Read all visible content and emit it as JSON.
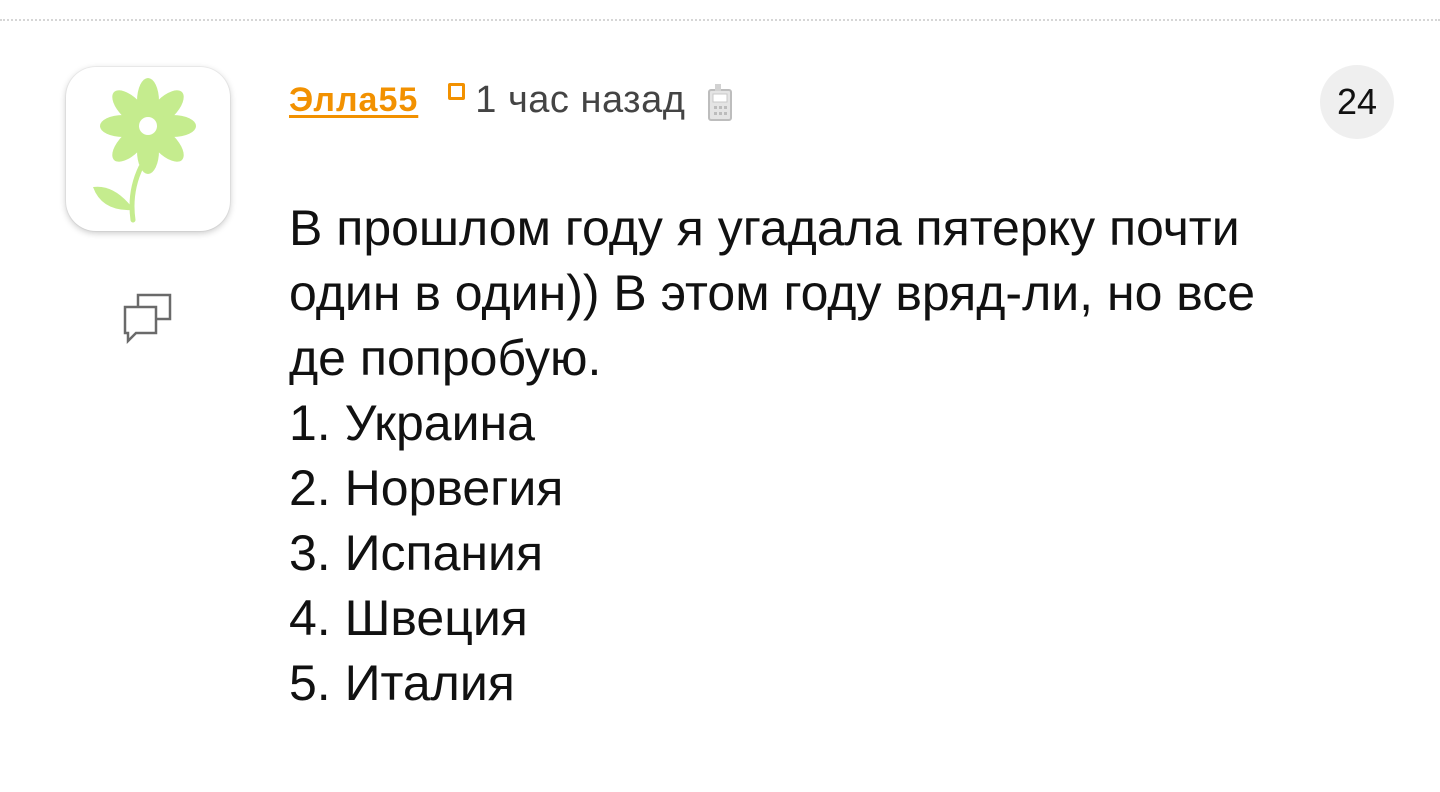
{
  "comment": {
    "author": "Элла55",
    "time": "1 час назад",
    "reply_count": "24",
    "text_lines": [
      "В прошлом году я угадала пятерку почти",
      "один в один)) В этом году вряд-ли, но все",
      "де попробую.",
      "1. Украина",
      "2. Норвегия",
      "3. Испания",
      "4. Швеция",
      "5. Италия"
    ]
  },
  "icons": {
    "avatar": "flower-avatar-icon",
    "status": "status-square-icon",
    "device": "mobile-phone-icon",
    "reply": "chat-bubbles-icon"
  },
  "colors": {
    "author": "#f29100",
    "status_square": "#f29100",
    "flower": "#c5ec8e",
    "badge_background": "#efefef",
    "text": "#111111",
    "muted": "#444444"
  }
}
